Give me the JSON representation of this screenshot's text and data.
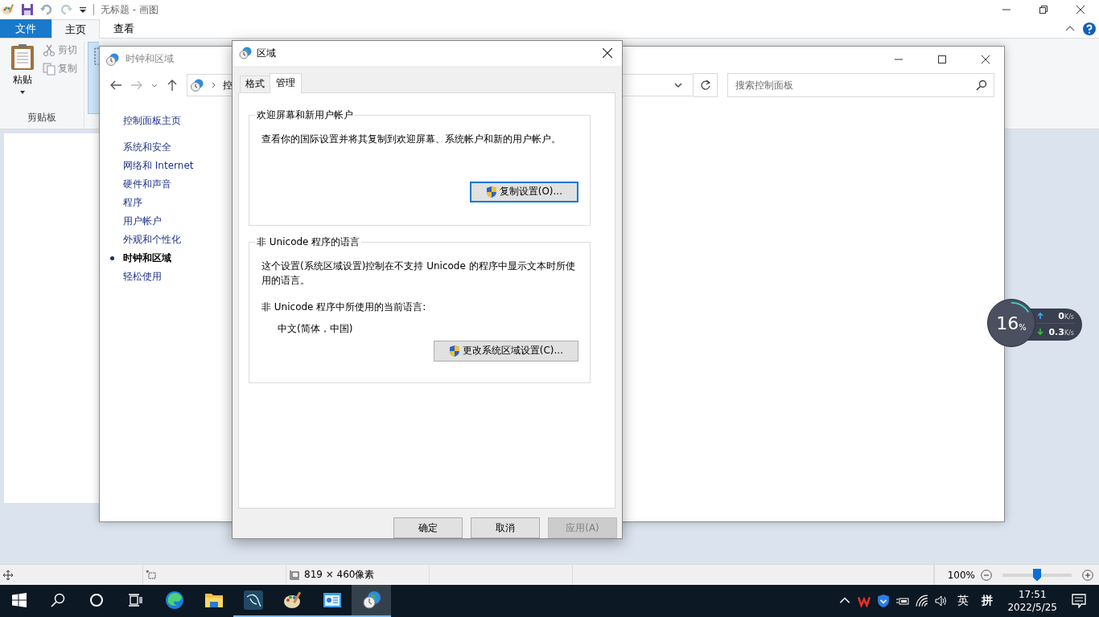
{
  "paint": {
    "title": "无标题 - 画图",
    "tabs": [
      {
        "label": "文件",
        "kind": "file",
        "selected": false
      },
      {
        "label": "主页",
        "kind": "tab",
        "selected": true
      },
      {
        "label": "查看",
        "kind": "tab",
        "selected": false
      }
    ],
    "clipboard": {
      "paste": "粘贴",
      "cut": {
        "label": "剪切",
        "disabled": true
      },
      "copy": {
        "label": "复制",
        "disabled": true
      },
      "group": "剪贴板"
    },
    "status": {
      "size": "819 × 460像素",
      "zoom": "100%",
      "zoom_slider": {
        "level": 0.5
      }
    }
  },
  "control_panel": {
    "title": "时钟和区域",
    "address": "控",
    "search": {
      "placeholder": "搜索控制面板"
    },
    "sidebar": {
      "home": "控制面板主页",
      "items": [
        {
          "label": "系统和安全",
          "selected": false
        },
        {
          "label": "网络和 Internet",
          "selected": false
        },
        {
          "label": "硬件和声音",
          "selected": false
        },
        {
          "label": "程序",
          "selected": false
        },
        {
          "label": "用户帐户",
          "selected": false
        },
        {
          "label": "外观和个性化",
          "selected": false
        },
        {
          "label": "时钟和区域",
          "selected": true
        },
        {
          "label": "轻松使用",
          "selected": false
        }
      ]
    }
  },
  "dialog": {
    "title": "区域",
    "tabs": [
      {
        "label": "格式",
        "selected": false
      },
      {
        "label": "管理",
        "selected": true
      }
    ],
    "groups": [
      {
        "title": "欢迎屏幕和新用户帐户",
        "text": "查看你的国际设置并将其复制到欢迎屏幕、系统帐户和新的用户帐户。",
        "button": {
          "label": "复制设置(O)...",
          "focused": true
        }
      },
      {
        "title": "非 Unicode 程序的语言",
        "text": "这个设置(系统区域设置)控制在不支持 Unicode 的程序中显示文本时所使用的语言。",
        "label": "非 Unicode 程序中所使用的当前语言:",
        "value": "中文(简体，中国)",
        "button": {
          "label": "更改系统区域设置(C)...",
          "focused": false
        }
      }
    ],
    "buttons": [
      {
        "label": "确定",
        "disabled": false
      },
      {
        "label": "取消",
        "disabled": false
      },
      {
        "label": "应用(A)",
        "disabled": true
      }
    ]
  },
  "net_monitor": {
    "cpu": "16",
    "cpu_unit": "%",
    "up": {
      "value": "0",
      "unit": "K/s"
    },
    "down": {
      "value": "0.3",
      "unit": "K/s"
    }
  },
  "taskbar": {
    "apps": [
      {
        "kind": "start",
        "open": false,
        "active": false
      },
      {
        "kind": "search",
        "open": false,
        "active": false
      },
      {
        "kind": "cortana",
        "open": false,
        "active": false
      },
      {
        "kind": "taskview",
        "open": false,
        "active": false
      },
      {
        "kind": "edge",
        "open": false,
        "active": false
      },
      {
        "kind": "explorer",
        "open": false,
        "active": false
      },
      {
        "kind": "dolphin",
        "open": true,
        "active": false
      },
      {
        "kind": "paint",
        "open": true,
        "active": false
      },
      {
        "kind": "dashboard",
        "open": true,
        "active": false
      },
      {
        "kind": "region",
        "open": true,
        "active": true
      }
    ],
    "tray": [
      {
        "kind": "chevron"
      },
      {
        "kind": "wps"
      },
      {
        "kind": "shield"
      },
      {
        "kind": "battery"
      },
      {
        "kind": "wifi"
      },
      {
        "kind": "volume"
      }
    ],
    "ime_mode": "英",
    "ime": "拼",
    "time": "17:51",
    "date": "2022/5/25"
  }
}
